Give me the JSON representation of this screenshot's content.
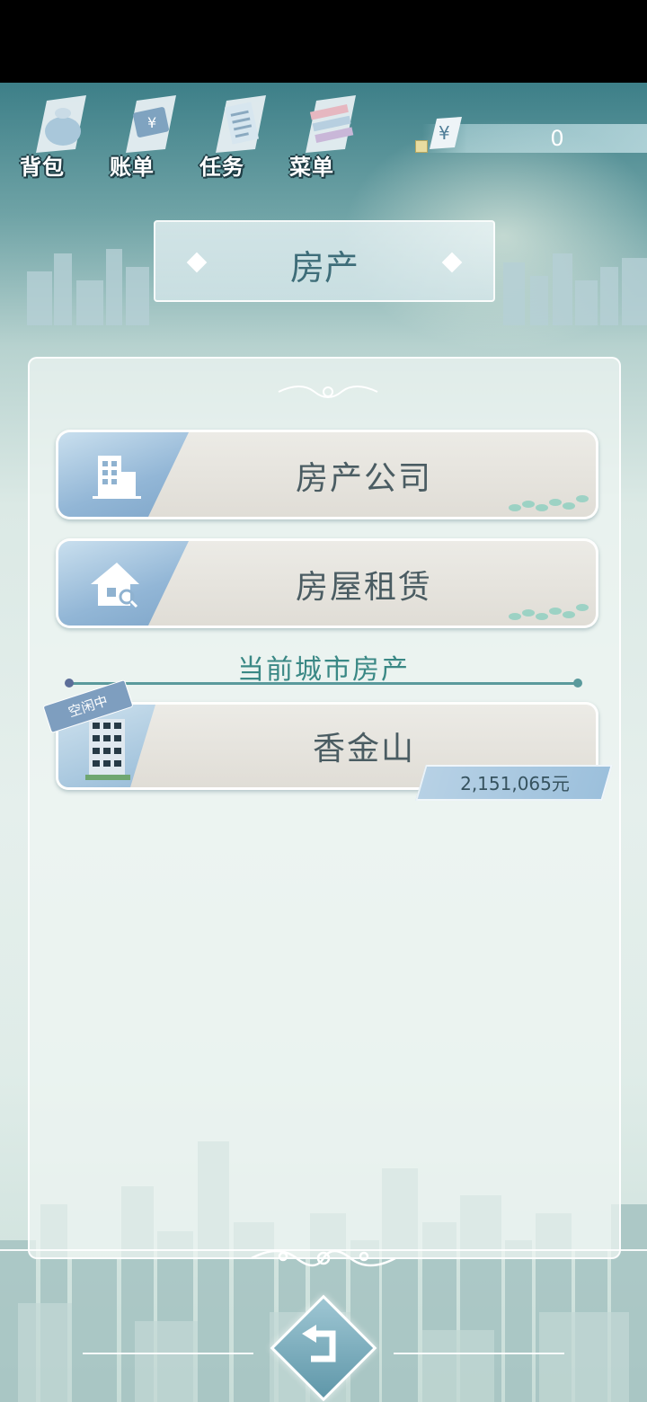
{
  "toolbar": {
    "items": [
      {
        "label": "背包",
        "icon": "bag-icon"
      },
      {
        "label": "账单",
        "icon": "bill-icon"
      },
      {
        "label": "任务",
        "icon": "task-icon"
      },
      {
        "label": "菜单",
        "icon": "menu-icon"
      }
    ],
    "currency_symbol": "¥",
    "money": "0"
  },
  "page": {
    "title": "房产"
  },
  "menu": {
    "items": [
      {
        "label": "房产公司",
        "icon": "building-icon"
      },
      {
        "label": "房屋租赁",
        "icon": "house-search-icon"
      }
    ]
  },
  "section": {
    "title": "当前城市房产"
  },
  "properties": [
    {
      "name": "香金山",
      "status": "空闲中",
      "price": "2,151,065元",
      "icon": "apartment-icon"
    }
  ],
  "colors": {
    "accent": "#3a8885",
    "title_text": "#3e6d79",
    "button_blue": "#92b6d6"
  }
}
